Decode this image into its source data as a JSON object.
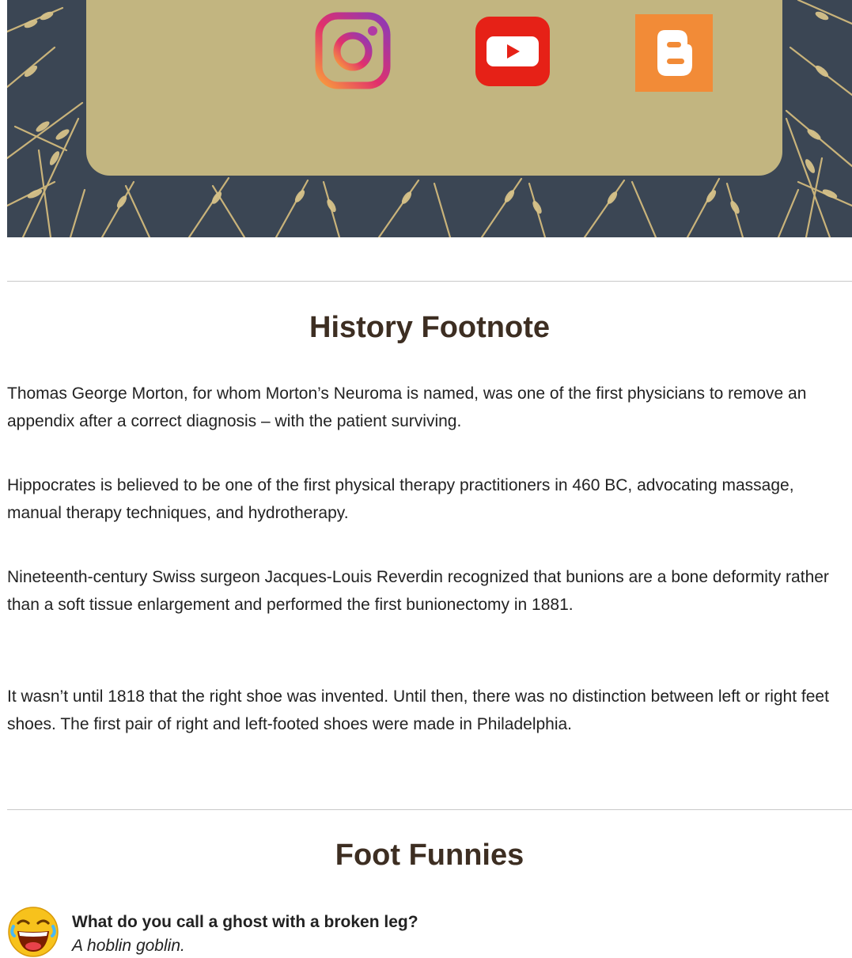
{
  "social": {
    "links": [
      {
        "name": "Instagram",
        "icon": "instagram-icon"
      },
      {
        "name": "YouTube",
        "icon": "youtube-icon"
      },
      {
        "name": "Blogger",
        "icon": "blogger-icon"
      }
    ]
  },
  "colors": {
    "banner_bg": "#3b4654",
    "card_bg": "#c2b580",
    "heading": "#3d2e22",
    "youtube_red": "#e62117",
    "blogger_orange": "#f28b37"
  },
  "history": {
    "title": "History Footnote",
    "paragraphs": [
      "Thomas George Morton, for whom Morton’s Neuroma is named, was one of the first physicians to remove an appendix after a correct diagnosis – with the patient surviving.",
      "Hippocrates is believed to be one of the first physical therapy practitioners in 460 BC, advocating massage, manual therapy techniques, and hydrotherapy.",
      "Nineteenth-century Swiss surgeon Jacques-Louis Reverdin recognized that bunions are a bone deformity rather than a soft tissue enlargement and performed the first bunionectomy in 1881.",
      "It wasn’t until 1818 that the right shoe was invented. Until then, there was no distinction between left or right feet shoes. The first pair of right and left-footed shoes were made in Philadelphia."
    ]
  },
  "funnies": {
    "title": "Foot Funnies",
    "icon": "laughing-emoji-icon",
    "question": "What do you call a ghost with a broken leg?",
    "answer": "A hoblin goblin."
  }
}
